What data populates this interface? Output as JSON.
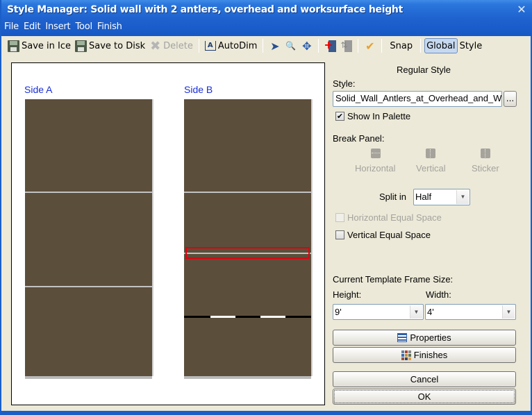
{
  "window": {
    "title": "Style Manager: Solid wall with 2 antlers, overhead and worksurface height",
    "close_glyph": "✕"
  },
  "menu": [
    "File",
    "Edit",
    "Insert",
    "Tool",
    "Finish"
  ],
  "toolbar": {
    "save_in_ice": "Save in Ice",
    "save_to_disk": "Save to Disk",
    "delete": "Delete",
    "autodim": "AutoDim",
    "icons": {
      "select": "➤",
      "zoom": "🔍",
      "pan": "✥",
      "add": "+",
      "break": "⇅",
      "check": "✔"
    },
    "snap": "Snap",
    "global": "Global",
    "style": "Style"
  },
  "canvas": {
    "side_a": "Side A",
    "side_b": "Side B",
    "colors": {
      "panel": "#5b4e3b",
      "divider": "#c2c2c2",
      "selection": "#e4000e"
    }
  },
  "panel": {
    "heading": "Regular Style",
    "style_label": "Style:",
    "style_value": "Solid_Wall_Antlers_at_Overhead_and_Worksurface",
    "browse_label": "...",
    "show_in_palette": {
      "label": "Show In Palette",
      "checked": true
    },
    "break_panel_label": "Break Panel:",
    "break_options": [
      "Horizontal",
      "Vertical",
      "Sticker"
    ],
    "split_label": "Split in",
    "split_value": "Half",
    "horizontal_equal_space": {
      "label": "Horizontal Equal Space",
      "checked": false,
      "enabled": false
    },
    "vertical_equal_space": {
      "label": "Vertical Equal Space",
      "checked": false,
      "enabled": true
    },
    "frame_size_label": "Current Template Frame Size:",
    "height_label": "Height:",
    "height_value": "9'",
    "width_label": "Width:",
    "width_value": "4'",
    "properties_btn": "Properties",
    "finishes_btn": "Finishes",
    "cancel_btn": "Cancel",
    "ok_btn": "OK"
  }
}
